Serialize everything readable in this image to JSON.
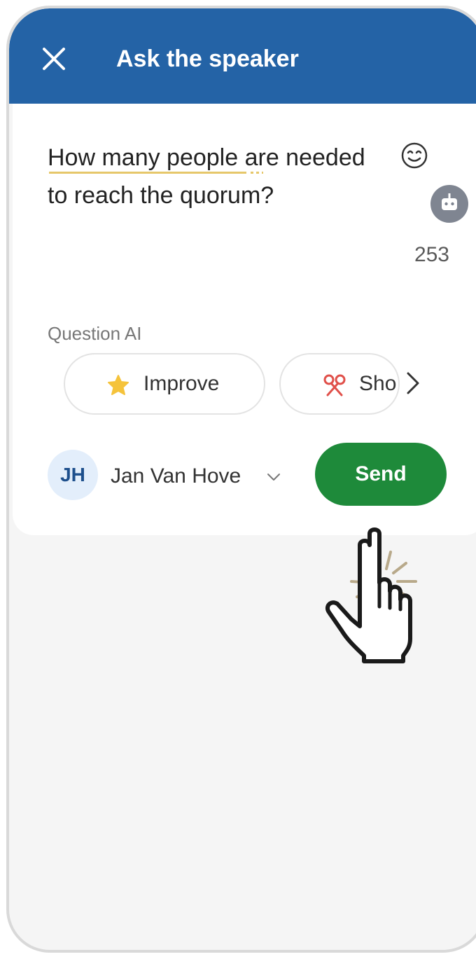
{
  "header": {
    "title": "Ask the speaker",
    "close_icon": "close-icon"
  },
  "question": {
    "line1": "How many people are needed",
    "line2": "to reach the quorum?",
    "emoji_icon": "smiling-face-icon",
    "assistant_icon": "robot-icon",
    "char_count": "253"
  },
  "question_ai": {
    "label": "Question AI",
    "buttons": [
      {
        "label": "Improve",
        "icon": "star-icon"
      },
      {
        "label": "Sho",
        "icon": "scissors-icon"
      }
    ],
    "next_icon": "chevron-right-icon"
  },
  "author": {
    "initials": "JH",
    "name": "Jan Van Hove",
    "dropdown_icon": "chevron-down-icon"
  },
  "send": {
    "label": "Send"
  },
  "colors": {
    "header": "#2463a6",
    "send": "#1e8a3a",
    "avatar_bg": "#e3eefb",
    "underline": "#e6c76a"
  }
}
